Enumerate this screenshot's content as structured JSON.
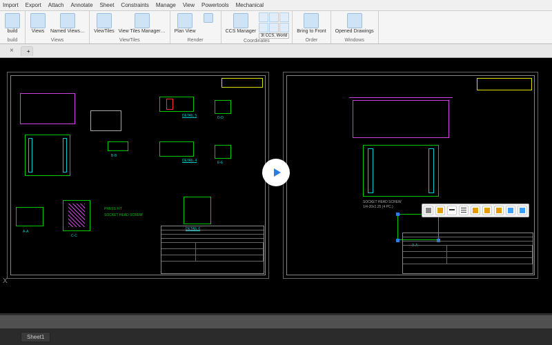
{
  "menu": {
    "items": [
      "Import",
      "Export",
      "Attach",
      "Annotate",
      "Sheet",
      "Constraints",
      "Manage",
      "View",
      "Powertools",
      "Mechanical"
    ]
  },
  "ribbon": {
    "groups": [
      {
        "title": "build",
        "buttons": [
          {
            "label": "build"
          }
        ]
      },
      {
        "title": "Views",
        "buttons": [
          {
            "label": "Views"
          },
          {
            "label": "Named\nViews…"
          }
        ]
      },
      {
        "title": "ViewTiles",
        "buttons": [
          {
            "label": "ViewTiles"
          },
          {
            "label": "View Tiles\nManager…"
          }
        ]
      },
      {
        "title": "Render",
        "buttons": [
          {
            "label": "Plan View"
          },
          {
            "label": ""
          }
        ]
      },
      {
        "title": "Coordinates",
        "buttons": [
          {
            "label": "CCS\nManager"
          }
        ],
        "dropdowns": [
          "",
          "",
          "3t CCS, World"
        ]
      },
      {
        "title": "Order",
        "buttons": [
          {
            "label": "Bring to\nFront"
          }
        ]
      },
      {
        "title": "Windows",
        "buttons": [
          {
            "label": "Opened\nDrawings"
          }
        ]
      }
    ]
  },
  "tabs": {
    "active": "",
    "plus": "+"
  },
  "left_sheet": {
    "details": [
      "DETAIL 5",
      "DETAIL 4",
      "DETAIL 6"
    ],
    "sections": [
      "A-A",
      "B-B",
      "C-C",
      "D-D",
      "E-E"
    ],
    "notes": [
      "PRESS FIT",
      "SOCKET HEAD SCREW"
    ],
    "titleblock": {
      "title": "",
      "scale": "",
      "drawn": ""
    }
  },
  "right_sheet": {
    "section": "A-A",
    "label1": "SOCKET HEAD SCREW",
    "label2": "1/4-20x1.25 (4 PC.)"
  },
  "minitoolbar": {
    "items": [
      "",
      "",
      "",
      "",
      "",
      "",
      "",
      "",
      ""
    ]
  },
  "bottom_tab": "Sheet1",
  "left_marker": "X"
}
